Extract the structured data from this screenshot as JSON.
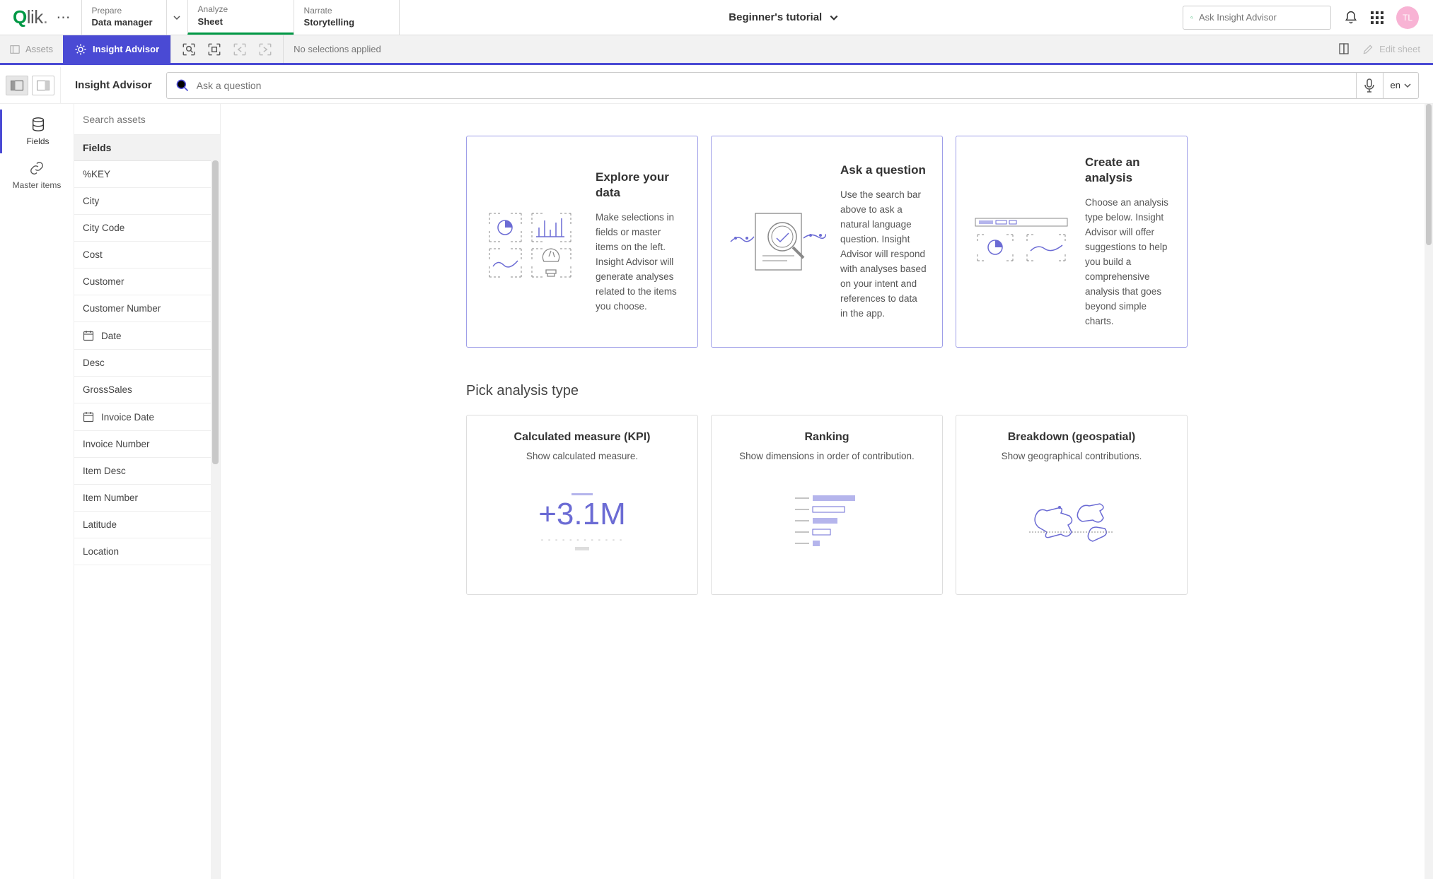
{
  "topnav": {
    "prepare_label": "Prepare",
    "prepare_sub": "Data manager",
    "analyze_label": "Analyze",
    "analyze_sub": "Sheet",
    "narrate_label": "Narrate",
    "narrate_sub": "Storytelling"
  },
  "app_title": "Beginner's tutorial",
  "top_search_placeholder": "Ask Insight Advisor",
  "avatar_initials": "TL",
  "subbar": {
    "assets": "Assets",
    "insight_advisor": "Insight Advisor",
    "no_selections": "No selections applied",
    "edit_sheet": "Edit sheet"
  },
  "panel_title": "Insight Advisor",
  "question_placeholder": "Ask a question",
  "lang": "en",
  "vnav": {
    "fields": "Fields",
    "master": "Master items"
  },
  "assets_panel": {
    "search_placeholder": "Search assets",
    "header": "Fields",
    "items": [
      {
        "label": "%KEY",
        "icon": null
      },
      {
        "label": "City",
        "icon": null
      },
      {
        "label": "City Code",
        "icon": null
      },
      {
        "label": "Cost",
        "icon": null
      },
      {
        "label": "Customer",
        "icon": null
      },
      {
        "label": "Customer Number",
        "icon": null
      },
      {
        "label": "Date",
        "icon": "date"
      },
      {
        "label": "Desc",
        "icon": null
      },
      {
        "label": "GrossSales",
        "icon": null
      },
      {
        "label": "Invoice Date",
        "icon": "date"
      },
      {
        "label": "Invoice Number",
        "icon": null
      },
      {
        "label": "Item Desc",
        "icon": null
      },
      {
        "label": "Item Number",
        "icon": null
      },
      {
        "label": "Latitude",
        "icon": null
      },
      {
        "label": "Location",
        "icon": null
      }
    ]
  },
  "intro_cards": [
    {
      "title": "Explore your data",
      "body": "Make selections in fields or master items on the left. Insight Advisor will generate analyses related to the items you choose."
    },
    {
      "title": "Ask a question",
      "body": "Use the search bar above to ask a natural language question. Insight Advisor will respond with analyses based on your intent and references to data in the app."
    },
    {
      "title": "Create an analysis",
      "body": "Choose an analysis type below. Insight Advisor will offer suggestions to help you build a comprehensive analysis that goes beyond simple charts."
    }
  ],
  "section_title": "Pick analysis type",
  "analysis_types": [
    {
      "title": "Calculated measure (KPI)",
      "desc": "Show calculated measure."
    },
    {
      "title": "Ranking",
      "desc": "Show dimensions in order of contribution."
    },
    {
      "title": "Breakdown (geospatial)",
      "desc": "Show geographical contributions."
    }
  ],
  "kpi_value": "+3.1M"
}
